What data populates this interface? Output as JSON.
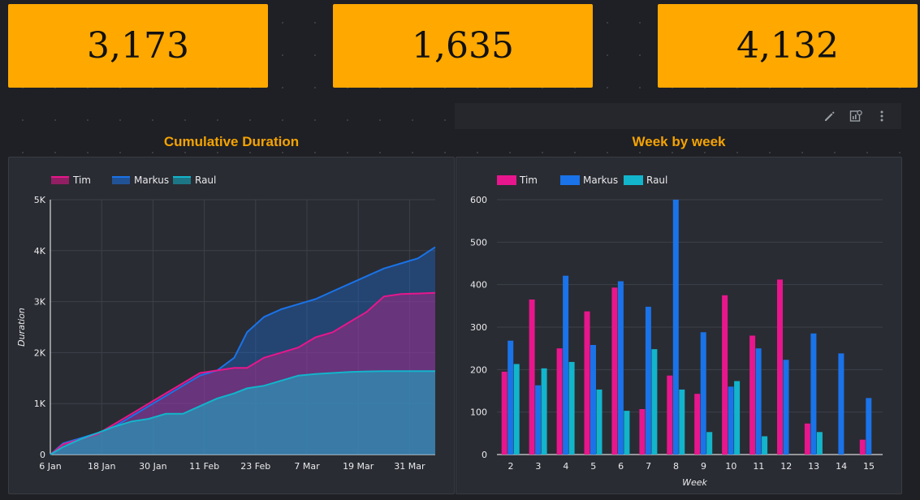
{
  "scorecards": [
    {
      "value": "3,173"
    },
    {
      "value": "1,635"
    },
    {
      "value": "4,132"
    }
  ],
  "toolbar": {
    "icons": [
      "edit-icon",
      "chart-settings-icon",
      "more-vert-icon"
    ]
  },
  "colors": {
    "tim": "#e8168c",
    "markus": "#1a73e8",
    "raul": "#12b5cb",
    "accent": "#ffa800",
    "title": "#f5a300"
  },
  "chart_data": [
    {
      "type": "area",
      "title": "Cumulative Duration",
      "ylabel": "Duration",
      "xlabel": "",
      "ylim": [
        0,
        5000
      ],
      "y_ticks": [
        "0",
        "1K",
        "2K",
        "3K",
        "4K",
        "5K"
      ],
      "x_ticks": [
        "6 Jan",
        "18 Jan",
        "30 Jan",
        "11 Feb",
        "23 Feb",
        "7 Mar",
        "19 Mar",
        "31 Mar"
      ],
      "legend_position": "top-left",
      "grid": true,
      "x_day_offsets": [
        0,
        12,
        24,
        36,
        48,
        60,
        72,
        84
      ],
      "series": [
        {
          "name": "Tim",
          "x": [
            0,
            3,
            7,
            11,
            15,
            19,
            23,
            27,
            31,
            35,
            39,
            43,
            46,
            50,
            54,
            58,
            62,
            66,
            70,
            74,
            78,
            82,
            86,
            90
          ],
          "y": [
            0,
            200,
            300,
            400,
            600,
            800,
            1000,
            1200,
            1400,
            1600,
            1650,
            1700,
            1700,
            1900,
            2000,
            2100,
            2300,
            2400,
            2600,
            2800,
            3100,
            3150,
            3160,
            3173
          ]
        },
        {
          "name": "Markus",
          "x": [
            0,
            3,
            7,
            11,
            15,
            19,
            23,
            27,
            31,
            35,
            39,
            43,
            46,
            50,
            54,
            58,
            62,
            66,
            70,
            74,
            78,
            82,
            86,
            90
          ],
          "y": [
            0,
            220,
            320,
            420,
            550,
            750,
            950,
            1150,
            1350,
            1550,
            1650,
            1900,
            2400,
            2700,
            2850,
            2950,
            3050,
            3200,
            3350,
            3500,
            3650,
            3750,
            3850,
            4070
          ]
        },
        {
          "name": "Raul",
          "x": [
            0,
            3,
            7,
            11,
            15,
            19,
            23,
            27,
            31,
            35,
            39,
            43,
            46,
            50,
            54,
            58,
            62,
            66,
            70,
            74,
            78,
            82,
            86,
            90
          ],
          "y": [
            0,
            150,
            300,
            420,
            550,
            650,
            700,
            800,
            800,
            950,
            1100,
            1200,
            1300,
            1350,
            1450,
            1550,
            1580,
            1600,
            1620,
            1630,
            1635,
            1635,
            1635,
            1635
          ]
        }
      ]
    },
    {
      "type": "bar",
      "title": "Week by week",
      "xlabel": "Week",
      "ylabel": "",
      "ylim": [
        0,
        600
      ],
      "y_ticks": [
        "0",
        "100",
        "200",
        "300",
        "400",
        "500",
        "600"
      ],
      "legend_position": "top-left",
      "grid": true,
      "categories": [
        "2",
        "3",
        "4",
        "5",
        "6",
        "7",
        "8",
        "9",
        "10",
        "11",
        "12",
        "13",
        "14",
        "15"
      ],
      "series": [
        {
          "name": "Tim",
          "values": [
            195,
            365,
            250,
            337,
            393,
            107,
            186,
            143,
            375,
            280,
            412,
            73,
            0,
            35
          ]
        },
        {
          "name": "Markus",
          "values": [
            268,
            163,
            421,
            258,
            408,
            348,
            600,
            288,
            160,
            250,
            223,
            285,
            238,
            133
          ]
        },
        {
          "name": "Raul",
          "values": [
            213,
            203,
            218,
            153,
            103,
            248,
            153,
            53,
            173,
            43,
            0,
            53,
            0,
            0
          ]
        }
      ]
    }
  ]
}
